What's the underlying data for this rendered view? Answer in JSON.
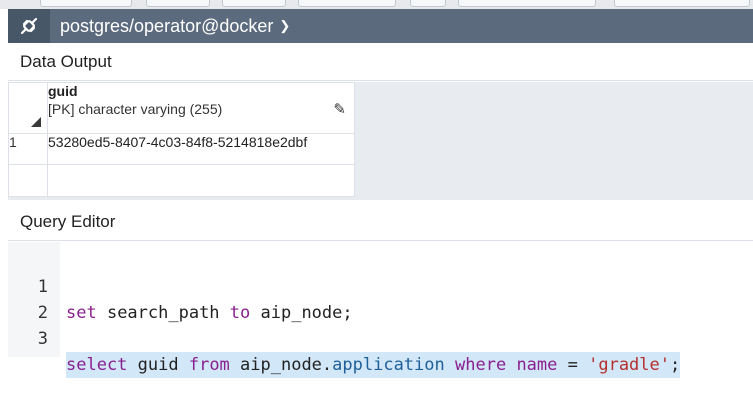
{
  "header": {
    "connection": "postgres/operator@docker",
    "icon": "connection-plug-icon"
  },
  "data_output": {
    "title": "Data Output",
    "columns": [
      {
        "name": "guid",
        "type": "[PK] character varying (255)"
      }
    ],
    "rows": [
      {
        "row_number": "1",
        "guid": "53280ed5-8407-4c03-84f8-5214818e2dbf"
      }
    ]
  },
  "query_editor": {
    "title": "Query Editor",
    "line_numbers": [
      "1",
      "2",
      "3"
    ],
    "tokens": {
      "l1_set": "set",
      "l1_search_path": " search_path ",
      "l1_to": "to",
      "l1_rest": " aip_node;",
      "l3_select": "select",
      "l3_guid": " guid ",
      "l3_from": "from",
      "l3_schema": " aip_node.",
      "l3_table": "application",
      "l3_sp": " ",
      "l3_where": "where",
      "l3_sp2": " ",
      "l3_name": "name",
      "l3_eq": " = ",
      "l3_str": "'gradle'",
      "l3_semi": ";"
    },
    "colors": {
      "keyword": "#8a1f8f",
      "property": "#1f5f99",
      "string": "#b5302d",
      "line_highlight": "#d2e7f8"
    }
  }
}
